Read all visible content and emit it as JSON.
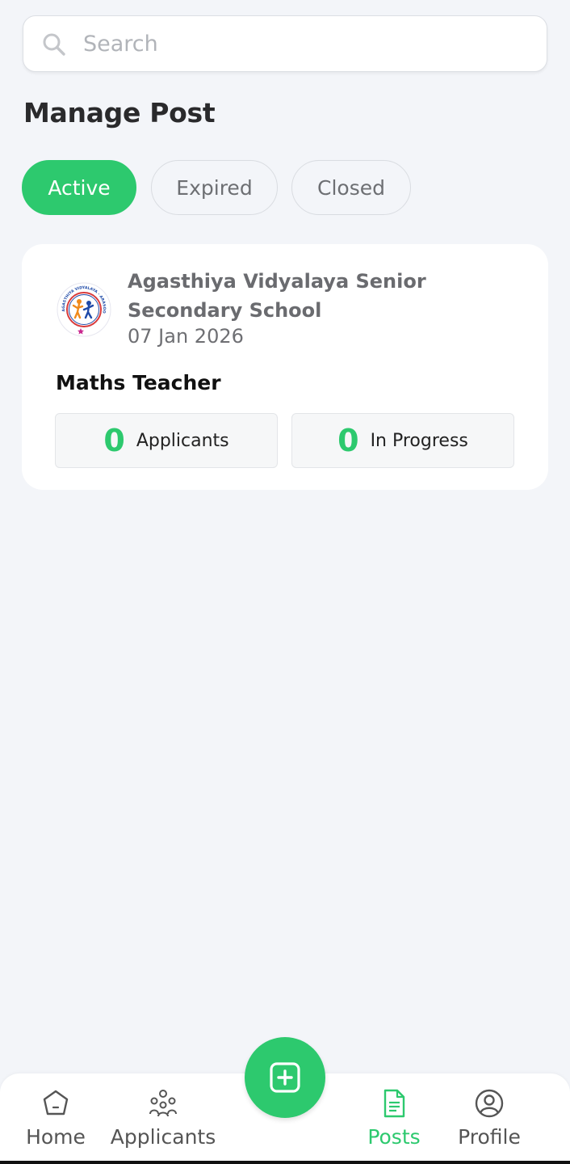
{
  "search": {
    "placeholder": "Search"
  },
  "page": {
    "title": "Manage Post"
  },
  "tabs": [
    {
      "label": "Active"
    },
    {
      "label": "Expired"
    },
    {
      "label": "Closed"
    }
  ],
  "post": {
    "school_name": "Agasthiya Vidyalaya Senior Secondary School",
    "logo_text": "AGASTHIYA VIDYALAYA - ARASOOR - VANDAVASI",
    "date": "07 Jan 2026",
    "role": "Maths Teacher",
    "stats": [
      {
        "count": "0",
        "label": "Applicants"
      },
      {
        "count": "0",
        "label": "In Progress"
      }
    ]
  },
  "nav": {
    "items": [
      {
        "label": "Home",
        "icon": "home-icon"
      },
      {
        "label": "Applicants",
        "icon": "applicants-icon"
      },
      {
        "label": "Posts",
        "icon": "posts-icon"
      },
      {
        "label": "Profile",
        "icon": "profile-icon"
      }
    ],
    "fab_icon": "add-post-icon"
  },
  "colors": {
    "accent": "#2dc96e",
    "background": "#f3f5f9",
    "card": "#ffffff"
  }
}
